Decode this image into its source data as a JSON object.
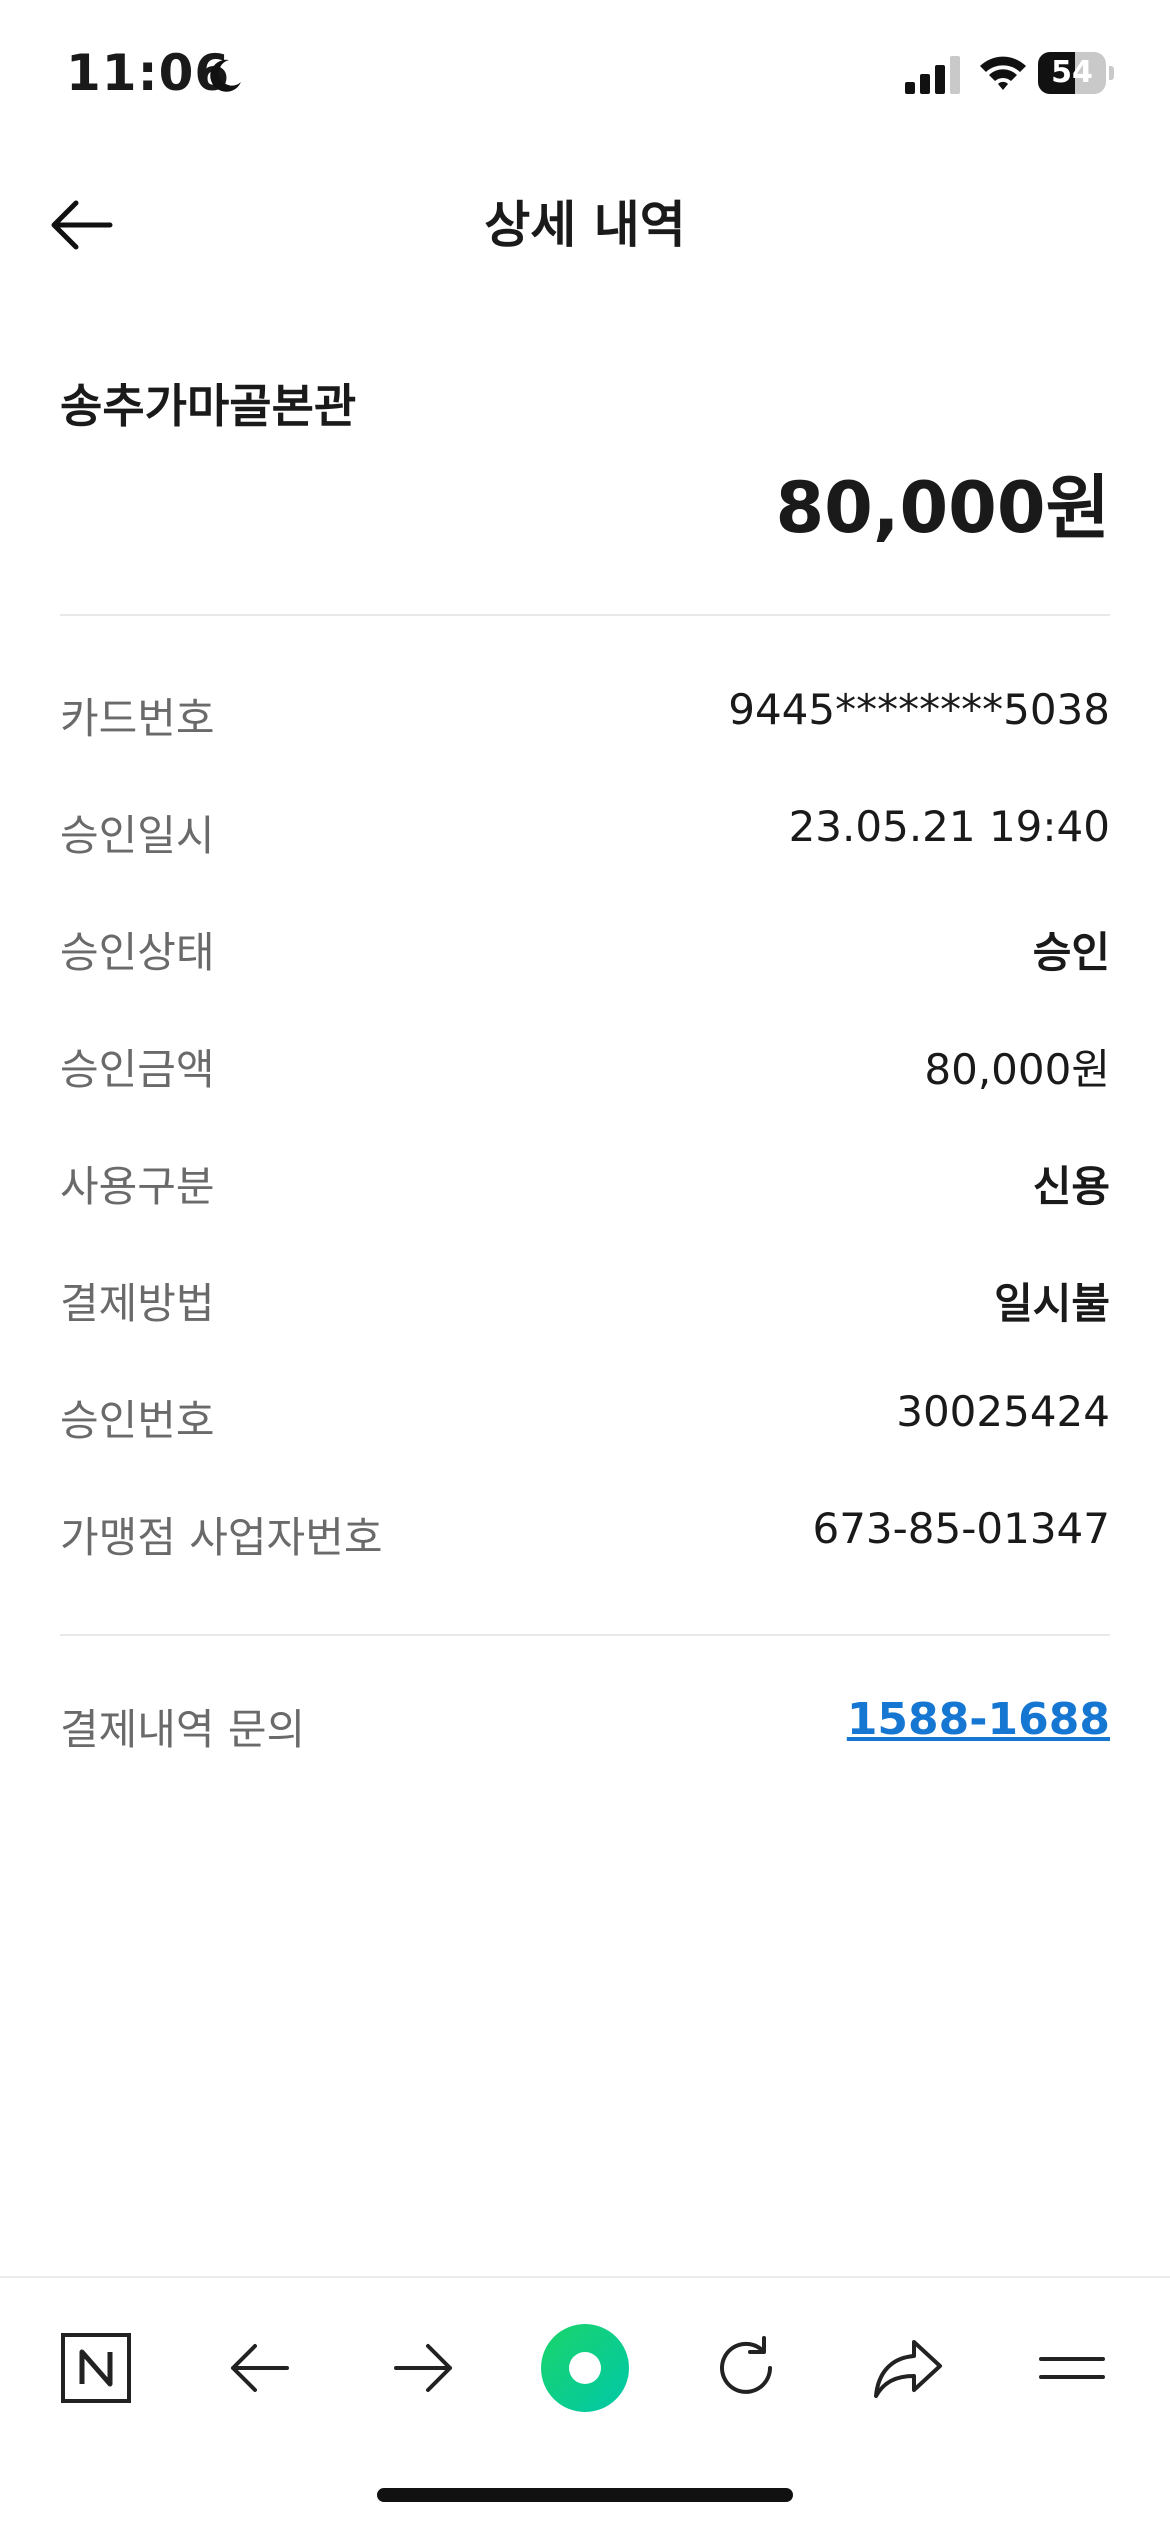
{
  "status_bar": {
    "time": "11:06",
    "battery": "54",
    "battery_level": 0.54
  },
  "header": {
    "title": "상세 내역"
  },
  "summary": {
    "merchant": "송추가마골본관",
    "amount": "80,000원"
  },
  "details": [
    {
      "label": "카드번호",
      "value": "9445********5038",
      "bold": false
    },
    {
      "label": "승인일시",
      "value": "23.05.21 19:40",
      "bold": false
    },
    {
      "label": "승인상태",
      "value": "승인",
      "bold": true
    },
    {
      "label": "승인금액",
      "value": "80,000원",
      "bold": false
    },
    {
      "label": "사용구분",
      "value": "신용",
      "bold": true
    },
    {
      "label": "결제방법",
      "value": "일시불",
      "bold": true
    },
    {
      "label": "승인번호",
      "value": "30025424",
      "bold": false
    },
    {
      "label": "가맹점 사업자번호",
      "value": "673-85-01347",
      "bold": false
    }
  ],
  "inquiry": {
    "label": "결제내역 문의",
    "phone": "1588-1688"
  },
  "toolbar": {
    "icons": [
      "naver-n-icon",
      "back-arrow-icon",
      "forward-arrow-icon",
      "green-dot-icon",
      "refresh-icon",
      "share-icon",
      "menu-icon"
    ],
    "accent_color": "#03c75a"
  },
  "colors": {
    "link": "#1677d2",
    "label": "#6a6a6a",
    "text": "#1a1a1a"
  }
}
